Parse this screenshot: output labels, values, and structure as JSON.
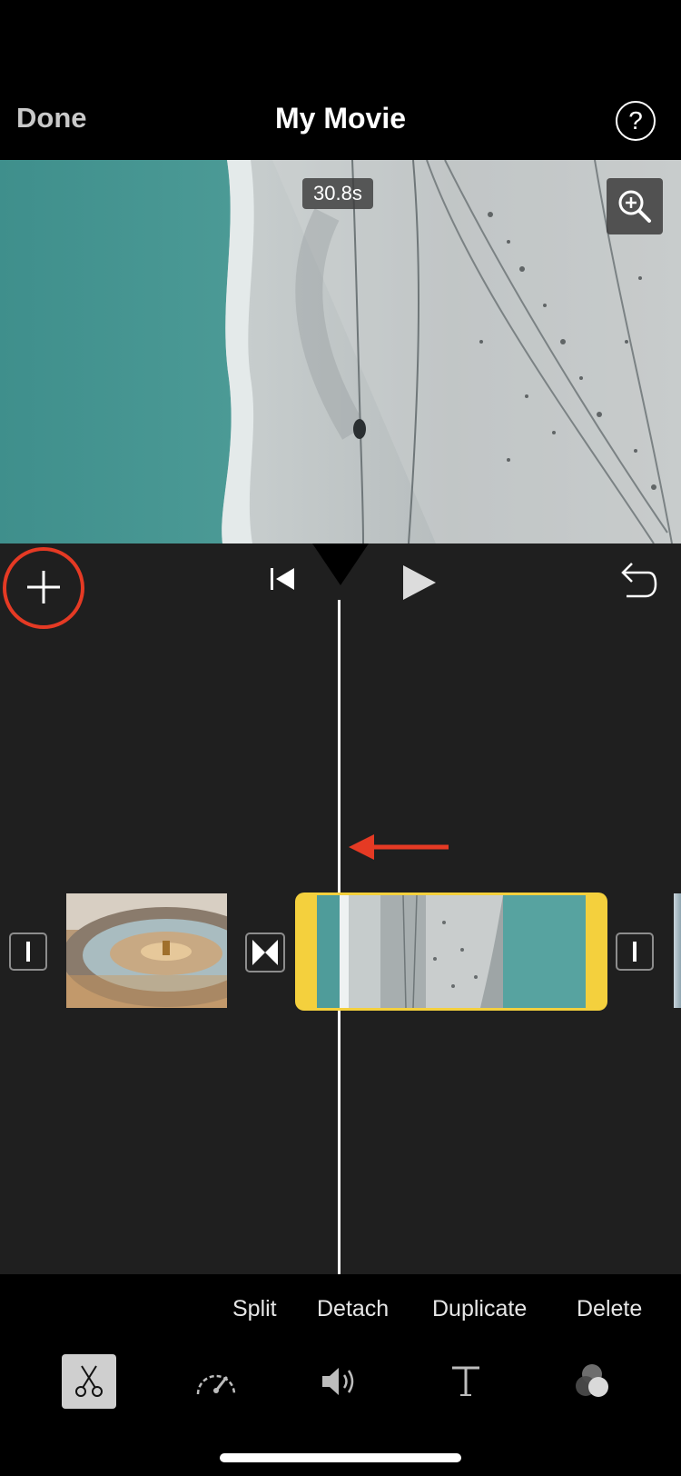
{
  "header": {
    "done_label": "Done",
    "title": "My Movie",
    "help_label": "?"
  },
  "preview": {
    "duration_badge": "30.8s",
    "zoom_icon": "zoom-in-icon"
  },
  "playback": {
    "add_icon": "plus-icon",
    "rewind_icon": "skip-to-start-icon",
    "play_icon": "play-icon",
    "undo_icon": "undo-icon"
  },
  "timeline": {
    "clips": [
      {
        "name": "record-player-clip"
      },
      {
        "name": "beach-aerial-clip",
        "selected": true
      }
    ]
  },
  "actions": {
    "split": "Split",
    "detach": "Detach",
    "duplicate": "Duplicate",
    "delete": "Delete"
  },
  "tools": [
    "scissors-icon",
    "speed-icon",
    "volume-icon",
    "text-icon",
    "filters-icon"
  ],
  "colors": {
    "accent_yellow": "#f4d03d",
    "annotation_red": "#e53a24",
    "editor_bg": "#1f1f1f"
  }
}
